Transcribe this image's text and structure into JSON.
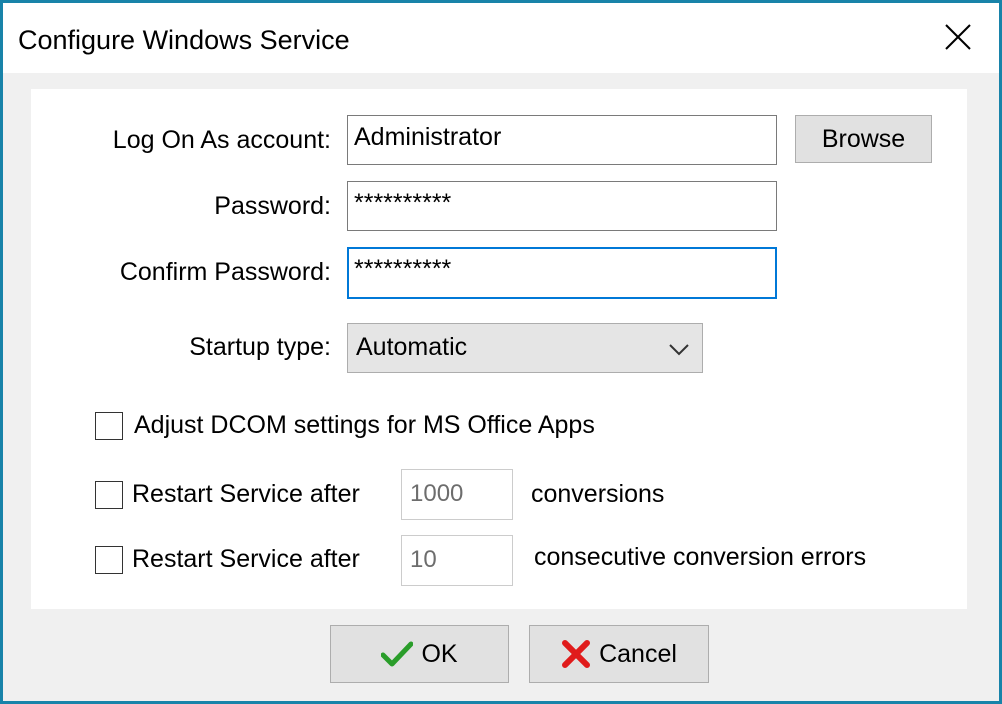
{
  "window": {
    "title": "Configure Windows Service",
    "accent_color": "#1883a9"
  },
  "form": {
    "account": {
      "label": "Log On As account:",
      "value": "Administrator"
    },
    "browse_label": "Browse",
    "password": {
      "label": "Password:",
      "value": "**********"
    },
    "confirm_password": {
      "label": "Confirm Password:",
      "value": "**********"
    },
    "startup": {
      "label": "Startup type:",
      "selected": "Automatic"
    },
    "dcom": {
      "label": "Adjust DCOM settings for MS Office Apps",
      "checked": false
    },
    "restart_conversions": {
      "label": "Restart Service after",
      "value": "1000",
      "suffix": "conversions",
      "checked": false
    },
    "restart_errors": {
      "label": "Restart Service after",
      "value": "10",
      "suffix": "consecutive conversion errors",
      "checked": false
    }
  },
  "footer": {
    "ok_label": "OK",
    "cancel_label": "Cancel"
  },
  "icons": {
    "ok": "checkmark-icon",
    "cancel": "red-x-icon",
    "close": "close-icon",
    "dropdown": "chevron-down-icon"
  }
}
